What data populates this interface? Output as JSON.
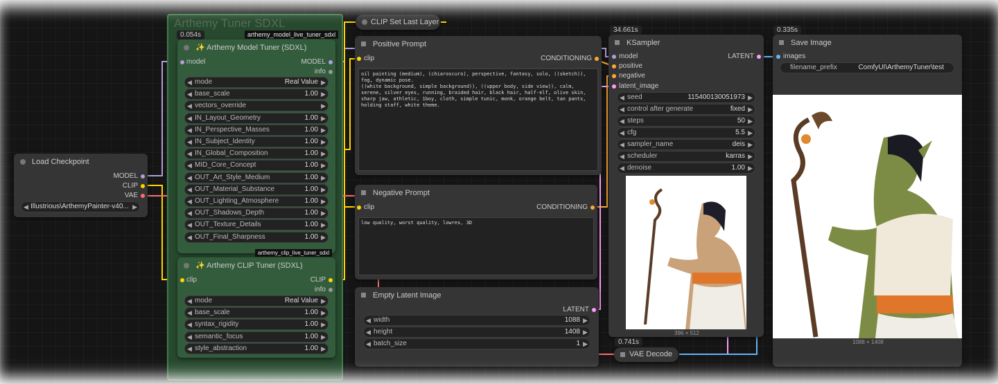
{
  "group": {
    "title": "Arthemy Tuner SDXL"
  },
  "timings": {
    "tuner": "0.054s",
    "ksampler": "34.661s",
    "save": "0.335s",
    "vae": "0.741s"
  },
  "badges": {
    "model_tuner": "arthemy_model_live_tuner_sdxl",
    "clip_tuner": "arthemy_clip_live_tuner_sdxl"
  },
  "load_checkpoint": {
    "title": "Load Checkpoint",
    "outputs": [
      "MODEL",
      "CLIP",
      "VAE"
    ],
    "ckpt_name": "Illustrious\\ArthemyPainter-v40..."
  },
  "model_tuner": {
    "title": "Arthemy Model Tuner (SDXL)",
    "input": "model",
    "outputs": [
      "MODEL",
      "info"
    ],
    "widgets": [
      {
        "label": "mode",
        "value": "Real Value"
      },
      {
        "label": "base_scale",
        "value": "1.00"
      },
      {
        "label": "vectors_override",
        "value": ""
      },
      {
        "label": "IN_Layout_Geometry",
        "value": "1.00"
      },
      {
        "label": "IN_Perspective_Masses",
        "value": "1.00"
      },
      {
        "label": "IN_Subject_Identity",
        "value": "1.00"
      },
      {
        "label": "IN_Global_Composition",
        "value": "1.00"
      },
      {
        "label": "MID_Core_Concept",
        "value": "1.00"
      },
      {
        "label": "OUT_Art_Style_Medium",
        "value": "1.00"
      },
      {
        "label": "OUT_Material_Substance",
        "value": "1.00"
      },
      {
        "label": "OUT_Lighting_Atmosphere",
        "value": "1.00"
      },
      {
        "label": "OUT_Shadows_Depth",
        "value": "1.00"
      },
      {
        "label": "OUT_Texture_Details",
        "value": "1.00"
      },
      {
        "label": "OUT_Final_Sharpness",
        "value": "1.00"
      }
    ]
  },
  "clip_tuner": {
    "title": "Arthemy CLIP Tuner (SDXL)",
    "input": "clip",
    "outputs": [
      "CLIP",
      "info"
    ],
    "widgets": [
      {
        "label": "mode",
        "value": "Real Value"
      },
      {
        "label": "base_scale",
        "value": "1.00"
      },
      {
        "label": "syntax_rigidity",
        "value": "1.00"
      },
      {
        "label": "semantic_focus",
        "value": "1.00"
      },
      {
        "label": "style_abstraction",
        "value": "1.00"
      }
    ]
  },
  "clip_set_last_layer": {
    "title": "CLIP Set Last Layer"
  },
  "positive_prompt": {
    "title": "Positive Prompt",
    "input": "clip",
    "output": "CONDITIONING",
    "text": "oil painting (medium), (chiaroscuro), perspective, fantasy, solo, ((sketch)), fog, dynamic pose.\n((white background, simple background)), ((upper body, side view)), calm, serene, silver eyes, running, braided hair, black hair, half-elf, olive skin, sharp jaw, athletic, 1boy, cloth, simple tunic, monk, orange belt, tan pants, holding staff, white theme."
  },
  "negative_prompt": {
    "title": "Negative Prompt",
    "input": "clip",
    "output": "CONDITIONING",
    "text": "low quality, worst quality, lowres, 3D"
  },
  "empty_latent": {
    "title": "Empty Latent Image",
    "output": "LATENT",
    "widgets": [
      {
        "label": "width",
        "value": "1088"
      },
      {
        "label": "height",
        "value": "1408"
      },
      {
        "label": "batch_size",
        "value": "1"
      }
    ]
  },
  "ksampler": {
    "title": "KSampler",
    "inputs": [
      "model",
      "positive",
      "negative",
      "latent_image"
    ],
    "output": "LATENT",
    "widgets": [
      {
        "label": "seed",
        "value": "115400130051973"
      },
      {
        "label": "control after generate",
        "value": "fixed"
      },
      {
        "label": "steps",
        "value": "50"
      },
      {
        "label": "cfg",
        "value": "5.5"
      },
      {
        "label": "sampler_name",
        "value": "deis"
      },
      {
        "label": "scheduler",
        "value": "karras"
      },
      {
        "label": "denoise",
        "value": "1.00"
      }
    ],
    "preview_size": "396 × 512"
  },
  "vae_decode": {
    "title": "VAE Decode"
  },
  "save_image": {
    "title": "Save Image",
    "input": "images",
    "widget": {
      "label": "filename_prefix",
      "value": "ComfyUI\\ArthemyTuner\\test"
    },
    "preview_size": "1088 × 1408"
  },
  "colors": {
    "model": "#b39ddb",
    "clip": "#ffd500",
    "vae": "#ff6e6e",
    "conditioning": "#ffa931",
    "latent": "#ff9cf9",
    "image": "#64b5f6"
  }
}
